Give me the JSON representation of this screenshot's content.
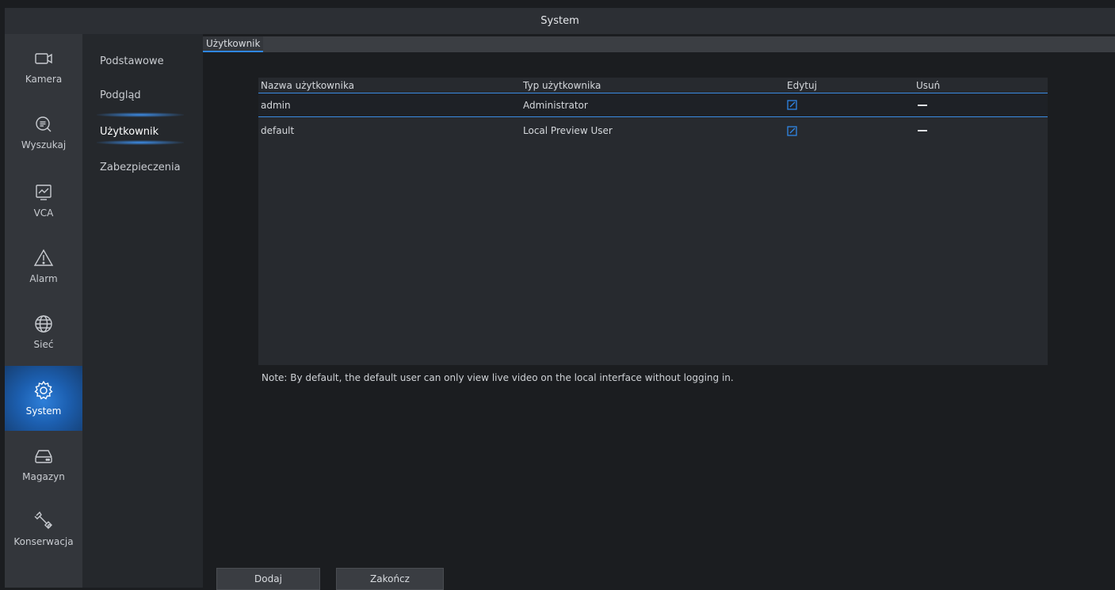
{
  "window": {
    "title": "System"
  },
  "rail": {
    "items": [
      {
        "label": "Kamera",
        "icon": "camera-icon"
      },
      {
        "label": "Wyszukaj",
        "icon": "search-icon"
      },
      {
        "label": "VCA",
        "icon": "vca-icon"
      },
      {
        "label": "Alarm",
        "icon": "alarm-icon"
      },
      {
        "label": "Sieć",
        "icon": "globe-icon"
      },
      {
        "label": "System",
        "icon": "gear-icon",
        "active": true
      },
      {
        "label": "Magazyn",
        "icon": "storage-icon"
      },
      {
        "label": "Konserwacja",
        "icon": "wrench-icon"
      }
    ]
  },
  "submenu": {
    "items": [
      {
        "label": "Podstawowe"
      },
      {
        "label": "Podgląd"
      },
      {
        "label": "Użytkownik",
        "active": true
      },
      {
        "label": "Zabezpieczenia"
      }
    ]
  },
  "tab": {
    "label": "Użytkownik"
  },
  "table": {
    "headers": [
      "Nazwa użytkownika",
      "Typ użytkownika",
      "Edytuj",
      "Usuń"
    ],
    "rows": [
      {
        "name": "admin",
        "type": "Administrator",
        "edit_icon": "edit-icon",
        "delete": "—"
      },
      {
        "name": "default",
        "type": "Local Preview User",
        "edit_icon": "edit-icon",
        "delete": "—"
      }
    ]
  },
  "note": "Note: By default, the default user can only view live video on the local interface without logging in.",
  "buttons": {
    "add": "Dodaj",
    "finish": "Zakończ"
  },
  "colors": {
    "accent": "#2f86e6",
    "active_rail": "#1c5fb0",
    "background": "#1b1d20"
  }
}
